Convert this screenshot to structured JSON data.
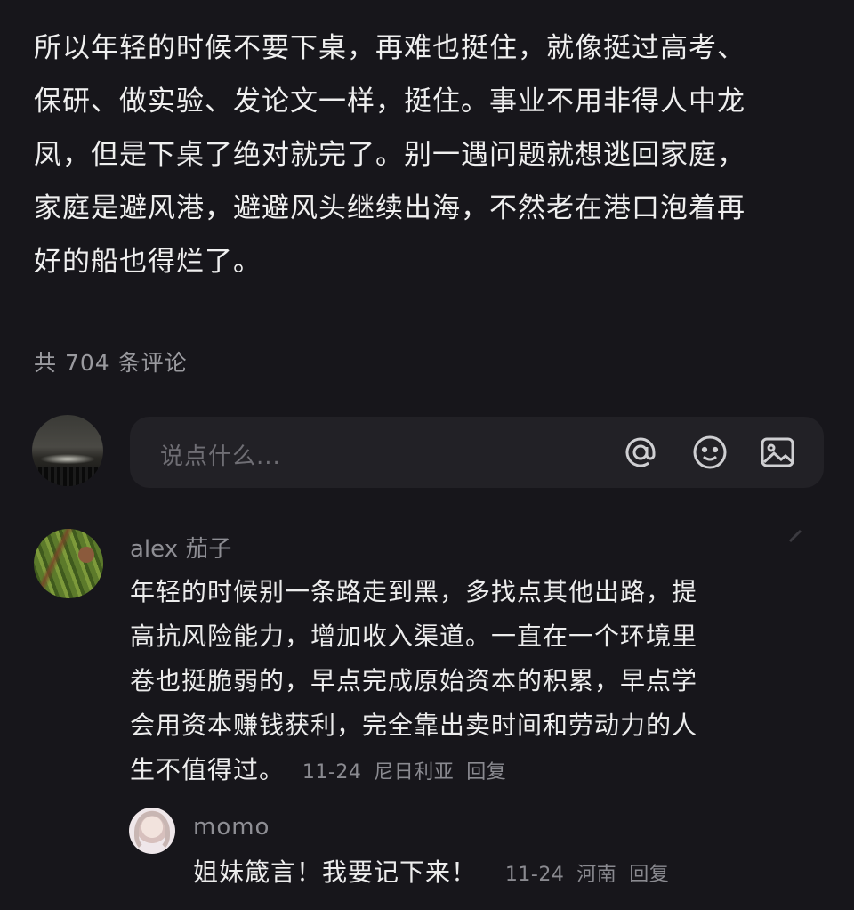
{
  "post": {
    "lines": [
      "所以年轻的时候不要下桌，再难也挺住，就像挺过高考、",
      "保研、做实验、发论文一样，挺住。事业不用非得人中龙",
      "凤，但是下桌了绝对就完了。别一遇问题就想逃回家庭，",
      "家庭是避风港，避避风头继续出海，不然老在港口泡着再",
      "好的船也得烂了。"
    ]
  },
  "comments_header": {
    "count_label": "共 704 条评论"
  },
  "input": {
    "placeholder": "说点什么...",
    "icons": [
      "at-icon",
      "emoji-icon",
      "image-icon"
    ]
  },
  "comment": {
    "username": "alex 茄子",
    "lines": [
      "年轻的时候别一条路走到黑，多找点其他出路，提",
      "高抗风险能力，增加收入渠道。一直在一个环境里",
      "卷也挺脆弱的，早点完成原始资本的积累，早点学",
      "会用资本赚钱获利，完全靠出卖时间和劳动力的人",
      "生不值得过。"
    ],
    "date": "11-24",
    "location": "尼日利亚",
    "reply_label": "回复"
  },
  "reply": {
    "username": "momo",
    "text": "姐妹箴言！我要记下来！",
    "date": "11-24",
    "location": "河南",
    "reply_label": "回复"
  },
  "colors": {
    "background": "#17161b",
    "input_bg": "#222126",
    "text_primary": "#ececec",
    "text_secondary": "#8e8e94"
  }
}
